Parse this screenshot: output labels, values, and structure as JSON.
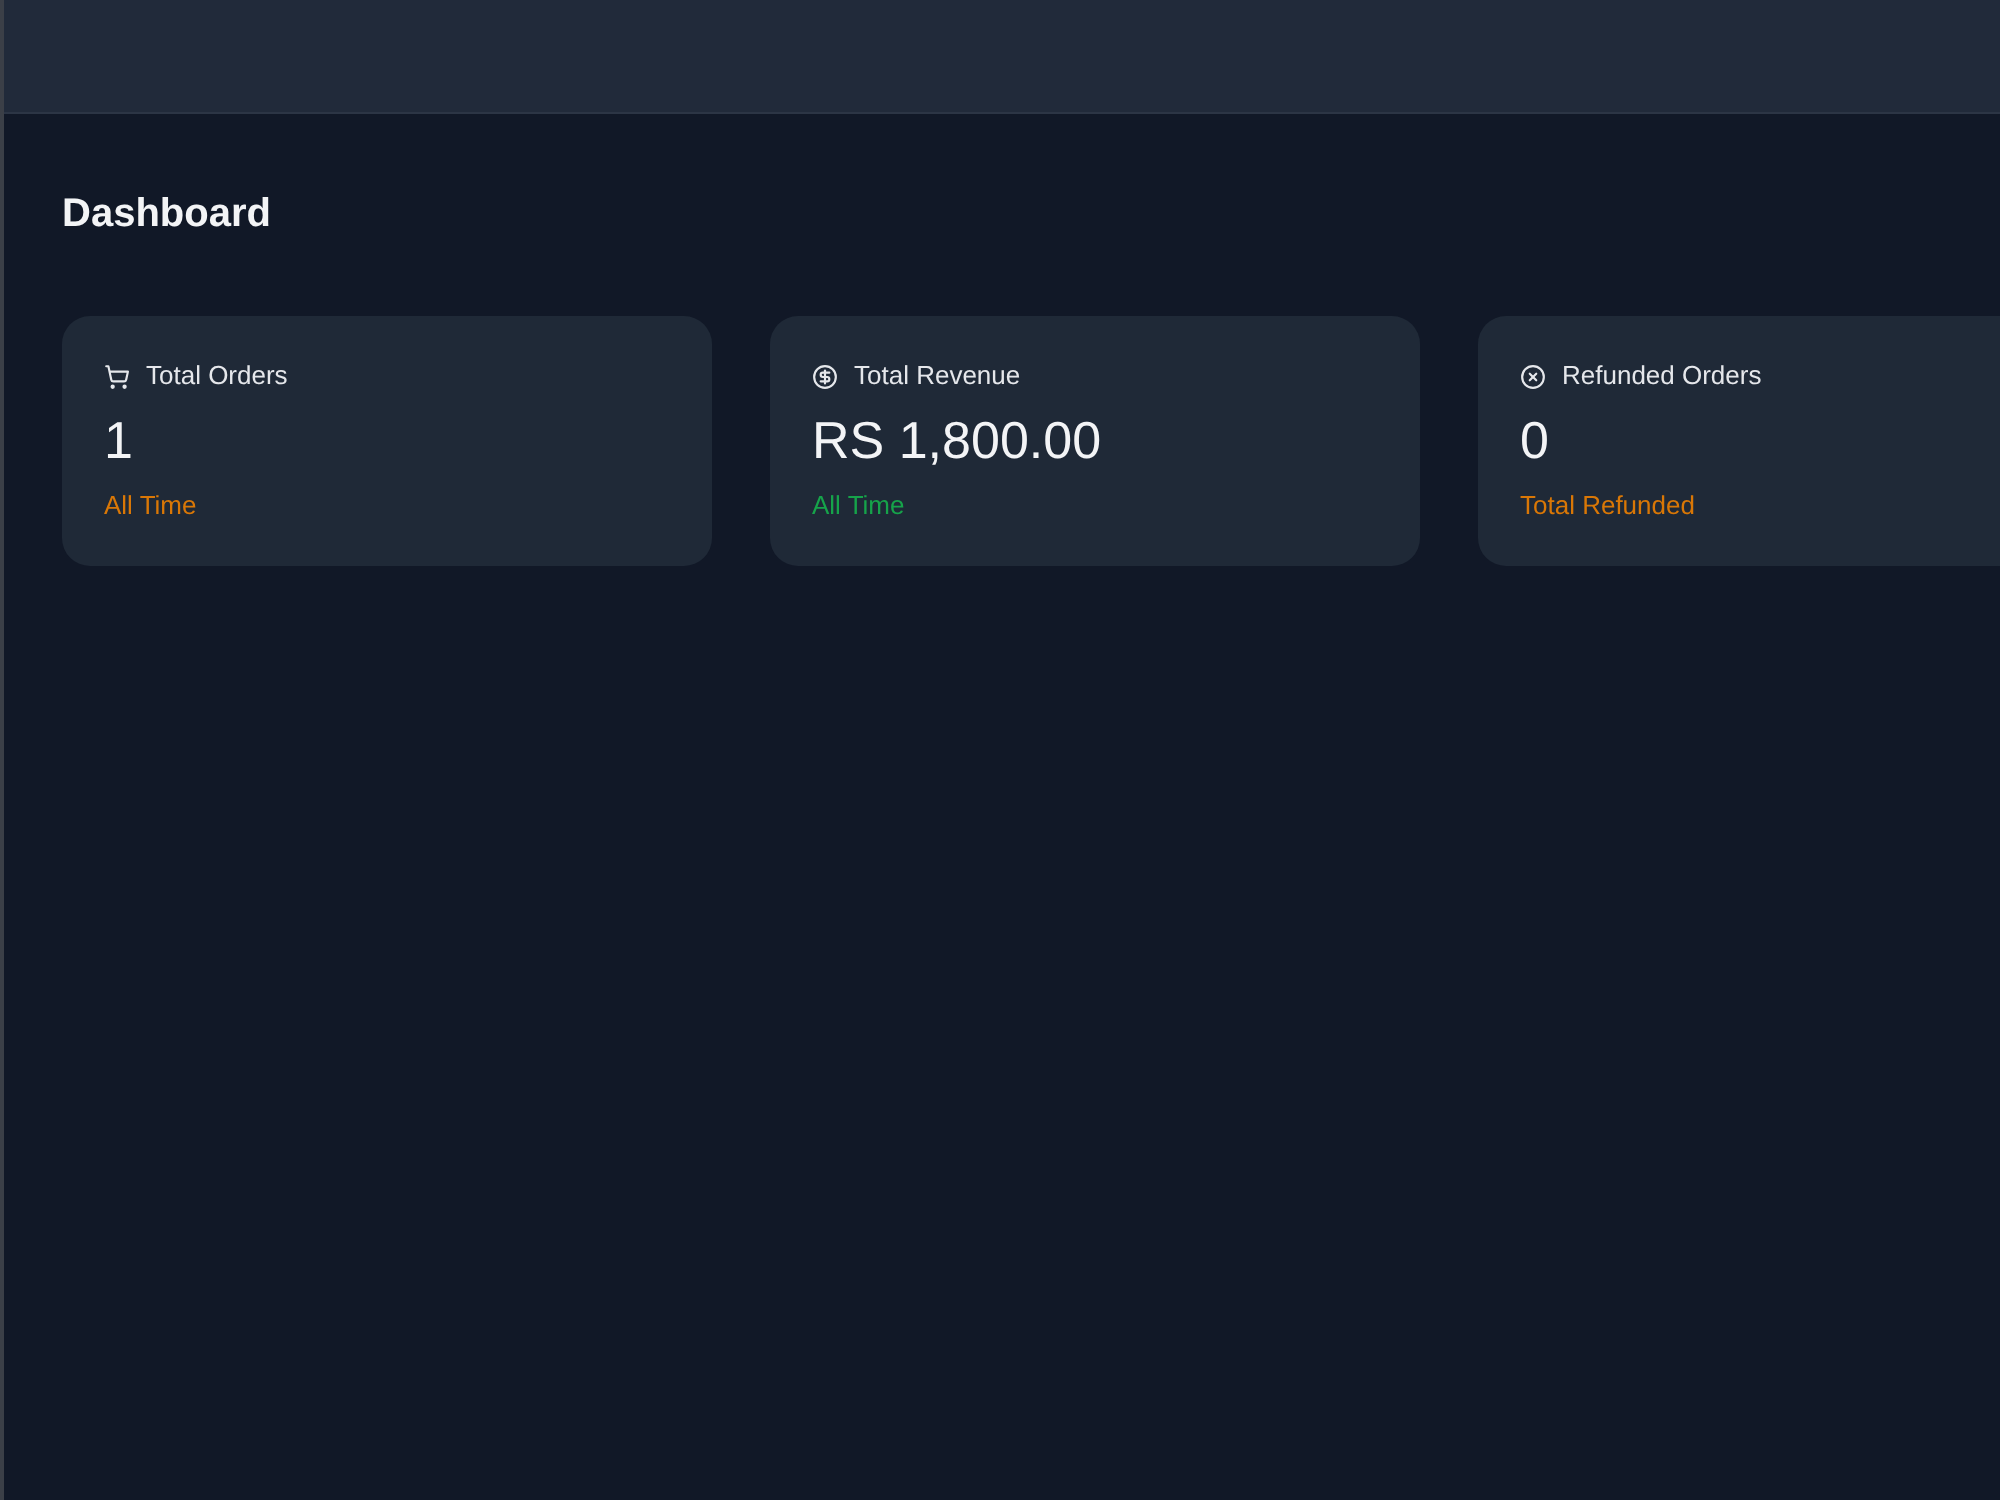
{
  "page": {
    "title": "Dashboard"
  },
  "cards": [
    {
      "label": "Total Orders",
      "value": "1",
      "note": "All Time",
      "color": "#d97706"
    },
    {
      "label": "Total Revenue",
      "value": "RS 1,800.00",
      "note": "All Time",
      "color": "#16a34a"
    },
    {
      "label": "Refunded Orders",
      "value": "0",
      "note": "Total Refunded",
      "color": "#d97706"
    }
  ]
}
